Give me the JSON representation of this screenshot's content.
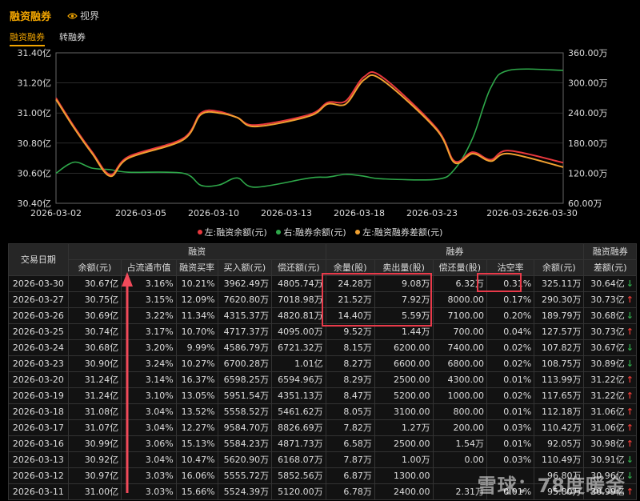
{
  "header": {
    "title": "融资融券",
    "view_label": "视界"
  },
  "tabs": [
    {
      "label": "融资融券",
      "active": true
    },
    {
      "label": "转融券",
      "active": false
    }
  ],
  "chart_data": {
    "type": "line",
    "x": [
      "2026-03-02",
      "2026-03-05",
      "2026-03-10",
      "2026-03-13",
      "2026-03-18",
      "2026-03-23",
      "2026-03-26",
      "2026-03-30"
    ],
    "x_tick_labels": [
      "2026-03-02",
      "2026-03-05",
      "2026-03-10",
      "2026-03-13",
      "2026-03-18",
      "2026-03-23",
      "2026-03-2626-03-30"
    ],
    "y_left": {
      "ticks": [
        "31.40亿",
        "31.20亿",
        "31.00亿",
        "30.80亿",
        "30.60亿",
        "30.40亿"
      ],
      "range": [
        30.4,
        31.4
      ]
    },
    "y_right": {
      "ticks": [
        "360.00万",
        "300.00万",
        "240.00万",
        "180.00万",
        "120.00万",
        "60.00万"
      ],
      "range": [
        60,
        360
      ]
    },
    "series": [
      {
        "name": "左:融资余额(元)",
        "color": "#e8383d",
        "axis": "left",
        "x": [
          "2026-03-02",
          "2026-03-03",
          "2026-03-04",
          "2026-03-05",
          "2026-03-06",
          "2026-03-09",
          "2026-03-10",
          "2026-03-11",
          "2026-03-12",
          "2026-03-13",
          "2026-03-16",
          "2026-03-17",
          "2026-03-18",
          "2026-03-19",
          "2026-03-20",
          "2026-03-23",
          "2026-03-24",
          "2026-03-25",
          "2026-03-26",
          "2026-03-27",
          "2026-03-30"
        ],
        "values": [
          31.1,
          30.91,
          30.74,
          30.59,
          30.71,
          30.83,
          31.0,
          31.01,
          30.97,
          30.92,
          30.99,
          31.07,
          31.08,
          31.24,
          31.24,
          30.9,
          30.68,
          30.74,
          30.69,
          30.75,
          30.67
        ]
      },
      {
        "name": "右:融券余额(元)",
        "color": "#2ea84a",
        "axis": "right",
        "x": [
          "2026-03-02",
          "2026-03-03",
          "2026-03-04",
          "2026-03-05",
          "2026-03-06",
          "2026-03-09",
          "2026-03-10",
          "2026-03-11",
          "2026-03-12",
          "2026-03-13",
          "2026-03-16",
          "2026-03-17",
          "2026-03-18",
          "2026-03-19",
          "2026-03-20",
          "2026-03-23",
          "2026-03-24",
          "2026-03-25",
          "2026-03-26",
          "2026-03-27",
          "2026-03-30"
        ],
        "values": [
          120.0,
          142.0,
          130.0,
          127.0,
          122.0,
          120.0,
          95.8,
          96.5,
          110.49,
          92.05,
          110.42,
          112.18,
          117.65,
          113.99,
          108.75,
          107.82,
          127.57,
          189.79,
          290.3,
          325.11,
          325.11
        ]
      },
      {
        "name": "左:融资融券差额(元)",
        "color": "#f0a030",
        "axis": "left",
        "x": [
          "2026-03-02",
          "2026-03-03",
          "2026-03-04",
          "2026-03-05",
          "2026-03-06",
          "2026-03-09",
          "2026-03-10",
          "2026-03-11",
          "2026-03-12",
          "2026-03-13",
          "2026-03-16",
          "2026-03-17",
          "2026-03-18",
          "2026-03-19",
          "2026-03-20",
          "2026-03-23",
          "2026-03-24",
          "2026-03-25",
          "2026-03-26",
          "2026-03-27",
          "2026-03-30"
        ],
        "values": [
          31.09,
          30.9,
          30.73,
          30.58,
          30.7,
          30.82,
          30.99,
          31.0,
          30.97,
          30.91,
          30.98,
          31.06,
          31.06,
          31.22,
          31.22,
          30.89,
          30.67,
          30.73,
          30.68,
          30.73,
          30.64
        ]
      }
    ],
    "grid": true,
    "legend_position": "bottom"
  },
  "table": {
    "group_headers": {
      "date": "交易日期",
      "financing": "融资",
      "securities": "融券",
      "diff": "融资融券"
    },
    "columns": [
      "余额(元)",
      "占流通市值",
      "融资买率",
      "买入额(元)",
      "偿还额(元)",
      "余量(股)",
      "卖出量(股)",
      "偿还量(股)",
      "沽空率",
      "余额(元)",
      "差额(元)"
    ],
    "rows": [
      {
        "date": "2026-03-30",
        "c": [
          "30.67亿",
          "3.16%",
          "10.21%",
          "3962.49万",
          "4805.74万",
          "24.28万",
          "9.08万",
          "6.32万",
          "0.31%",
          "325.11万",
          "30.64亿"
        ],
        "trend": "down"
      },
      {
        "date": "2026-03-27",
        "c": [
          "30.75亿",
          "3.15%",
          "12.09%",
          "7620.80万",
          "7018.98万",
          "21.52万",
          "7.92万",
          "8000.00",
          "0.17%",
          "290.30万",
          "30.73亿"
        ],
        "trend": "up"
      },
      {
        "date": "2026-03-26",
        "c": [
          "30.69亿",
          "3.22%",
          "11.34%",
          "4315.37万",
          "4820.81万",
          "14.40万",
          "5.59万",
          "7100.00",
          "0.20%",
          "189.79万",
          "30.68亿"
        ],
        "trend": "down"
      },
      {
        "date": "2026-03-25",
        "c": [
          "30.74亿",
          "3.17%",
          "10.70%",
          "4717.37万",
          "4095.00万",
          "9.52万",
          "1.44万",
          "700.00",
          "0.04%",
          "127.57万",
          "30.73亿"
        ],
        "trend": "up"
      },
      {
        "date": "2026-03-24",
        "c": [
          "30.68亿",
          "3.20%",
          "9.99%",
          "4586.79万",
          "6721.32万",
          "8.15万",
          "6200.00",
          "7400.00",
          "0.02%",
          "107.82万",
          "30.67亿"
        ],
        "trend": "down"
      },
      {
        "date": "2026-03-23",
        "c": [
          "30.90亿",
          "3.24%",
          "10.27%",
          "6700.28万",
          "1.01亿",
          "8.27万",
          "6600.00",
          "6800.00",
          "0.02%",
          "108.75万",
          "30.89亿"
        ],
        "trend": "down"
      },
      {
        "date": "2026-03-20",
        "c": [
          "31.24亿",
          "3.14%",
          "16.37%",
          "6598.25万",
          "6594.96万",
          "8.29万",
          "2500.00",
          "4300.00",
          "0.01%",
          "113.99万",
          "31.22亿"
        ],
        "trend": "up"
      },
      {
        "date": "2026-03-19",
        "c": [
          "31.24亿",
          "3.10%",
          "13.05%",
          "5951.54万",
          "4351.13万",
          "8.47万",
          "5200.00",
          "1000.00",
          "0.02%",
          "117.65万",
          "31.22亿"
        ],
        "trend": "up"
      },
      {
        "date": "2026-03-18",
        "c": [
          "31.08亿",
          "3.04%",
          "13.52%",
          "5558.52万",
          "5461.62万",
          "8.05万",
          "3100.00",
          "800.00",
          "0.01%",
          "112.18万",
          "31.06亿"
        ],
        "trend": "up"
      },
      {
        "date": "2026-03-17",
        "c": [
          "31.07亿",
          "3.04%",
          "12.27%",
          "9584.70万",
          "8826.69万",
          "7.82万",
          "1.27万",
          "200.00",
          "0.03%",
          "110.42万",
          "31.06亿"
        ],
        "trend": "up"
      },
      {
        "date": "2026-03-16",
        "c": [
          "30.99亿",
          "3.06%",
          "15.13%",
          "5584.23万",
          "4871.73万",
          "6.58万",
          "2500.00",
          "1.54万",
          "0.01%",
          "92.05万",
          "30.98亿"
        ],
        "trend": "up"
      },
      {
        "date": "2026-03-13",
        "c": [
          "30.92亿",
          "3.04%",
          "10.47%",
          "5620.90万",
          "6168.07万",
          "7.87万",
          "1.00万",
          "0.00",
          "0.03%",
          "110.49万",
          "30.91亿"
        ],
        "trend": "down"
      },
      {
        "date": "2026-03-12",
        "c": [
          "30.97亿",
          "3.03%",
          "16.06%",
          "5555.72万",
          "5852.56万",
          "6.87万",
          "1300.00",
          "",
          "",
          "96.80万",
          "30.96亿"
        ],
        "trend": "down"
      },
      {
        "date": "2026-03-11",
        "c": [
          "31.00亿",
          "3.03%",
          "15.66%",
          "5524.39万",
          "5120.00万",
          "6.78万",
          "2400.00",
          "2.31万",
          "0.01%",
          "95.80万",
          "30.99亿"
        ],
        "trend": "up"
      }
    ]
  },
  "watermark": "雪球：78度暖金",
  "colors": {
    "accent": "#f2a500",
    "highlight": "#e83a4a",
    "up": "#e53935",
    "down": "#2ea84a"
  }
}
